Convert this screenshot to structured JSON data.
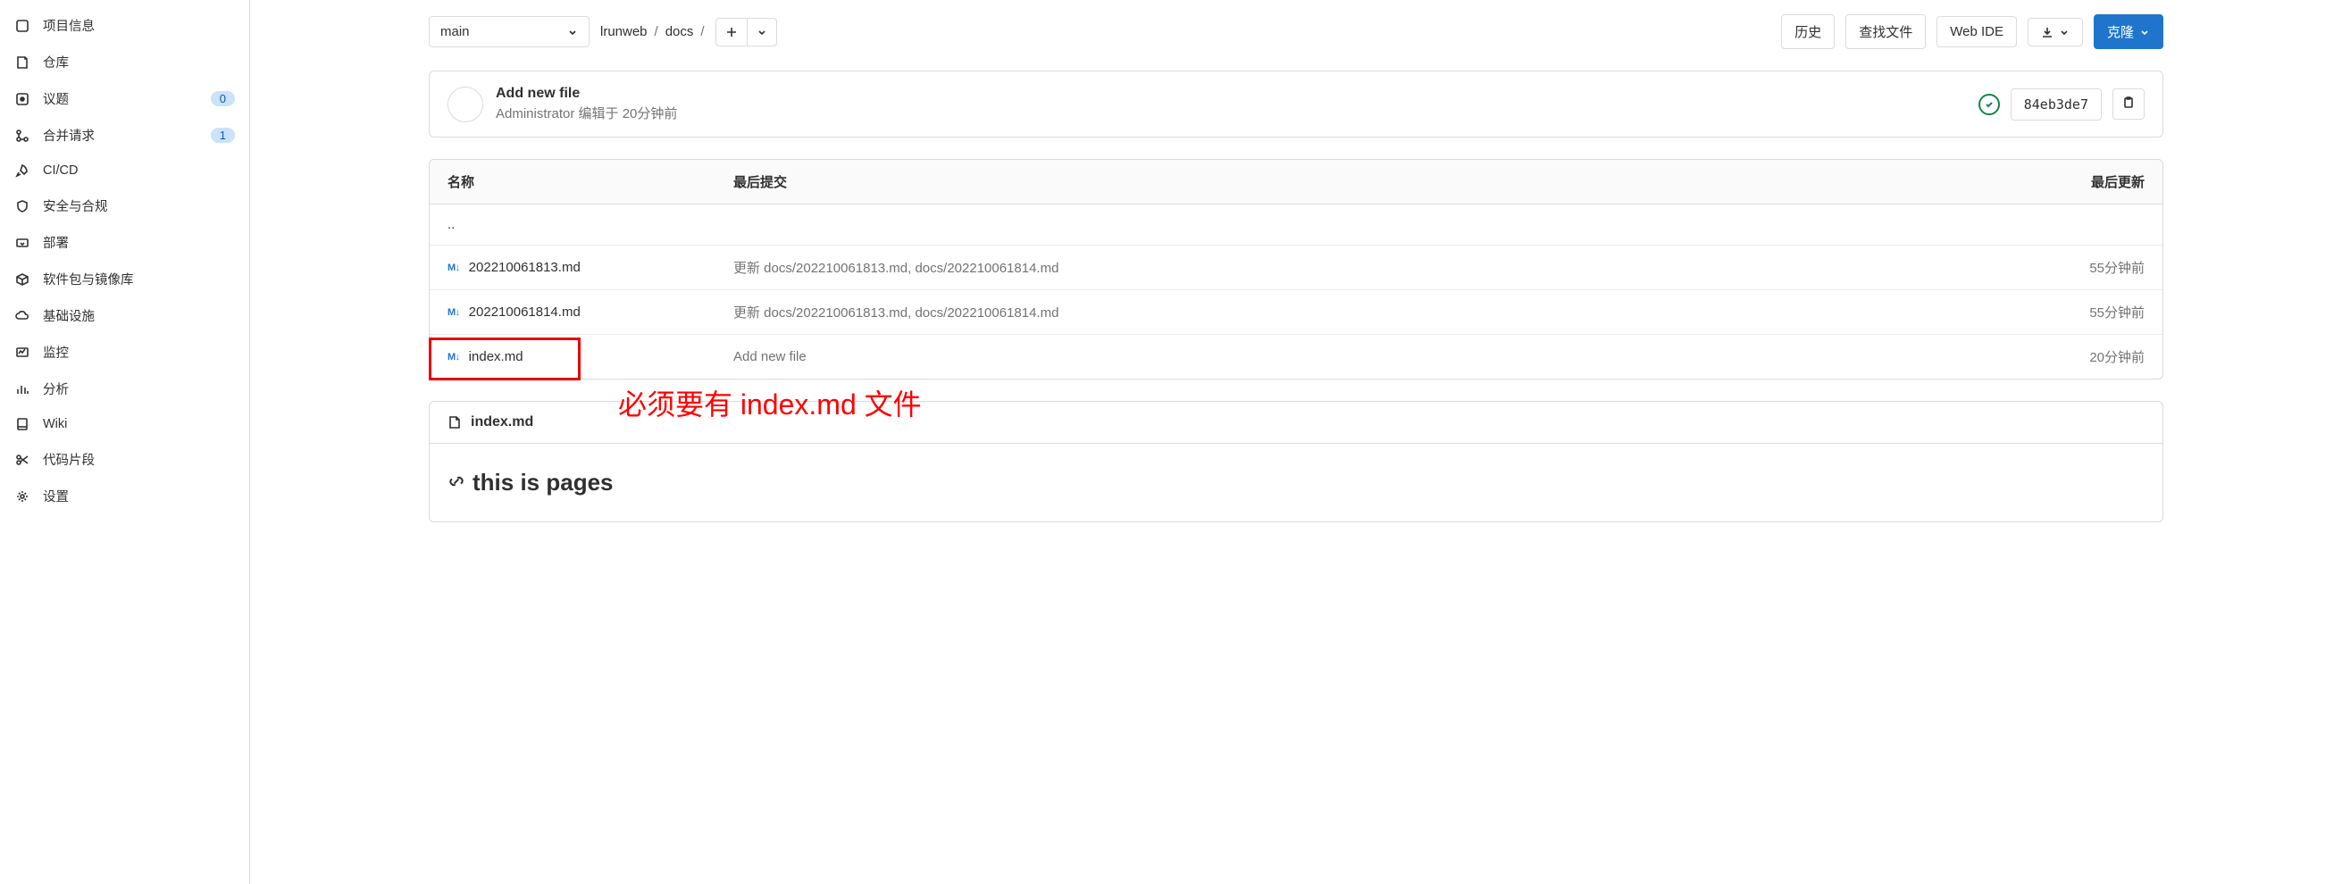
{
  "sidebar": {
    "items": [
      {
        "label": "项目信息"
      },
      {
        "label": "仓库"
      },
      {
        "label": "议题",
        "badge": "0"
      },
      {
        "label": "合并请求",
        "badge": "1"
      },
      {
        "label": "CI/CD"
      },
      {
        "label": "安全与合规"
      },
      {
        "label": "部署"
      },
      {
        "label": "软件包与镜像库"
      },
      {
        "label": "基础设施"
      },
      {
        "label": "监控"
      },
      {
        "label": "分析"
      },
      {
        "label": "Wiki"
      },
      {
        "label": "代码片段"
      },
      {
        "label": "设置"
      }
    ]
  },
  "toolbar": {
    "branch": "main",
    "breadcrumb": [
      "lrunweb",
      "docs"
    ],
    "history": "历史",
    "find_file": "查找文件",
    "web_ide": "Web IDE",
    "clone": "克隆"
  },
  "commit": {
    "message": "Add new file",
    "author": "Administrator",
    "edited": "编辑于",
    "time": "20分钟前",
    "sha": "84eb3de7"
  },
  "table": {
    "head_name": "名称",
    "head_commit": "最后提交",
    "head_time": "最后更新",
    "parent": "..",
    "rows": [
      {
        "name": "202210061813.md",
        "commit": "更新 docs/202210061813.md, docs/202210061814.md",
        "time": "55分钟前"
      },
      {
        "name": "202210061814.md",
        "commit": "更新 docs/202210061813.md, docs/202210061814.md",
        "time": "55分钟前"
      },
      {
        "name": "index.md",
        "commit": "Add new file",
        "time": "20分钟前"
      }
    ]
  },
  "annotation": "必须要有 index.md 文件",
  "readme": {
    "filename": "index.md",
    "heading": "this is pages"
  }
}
